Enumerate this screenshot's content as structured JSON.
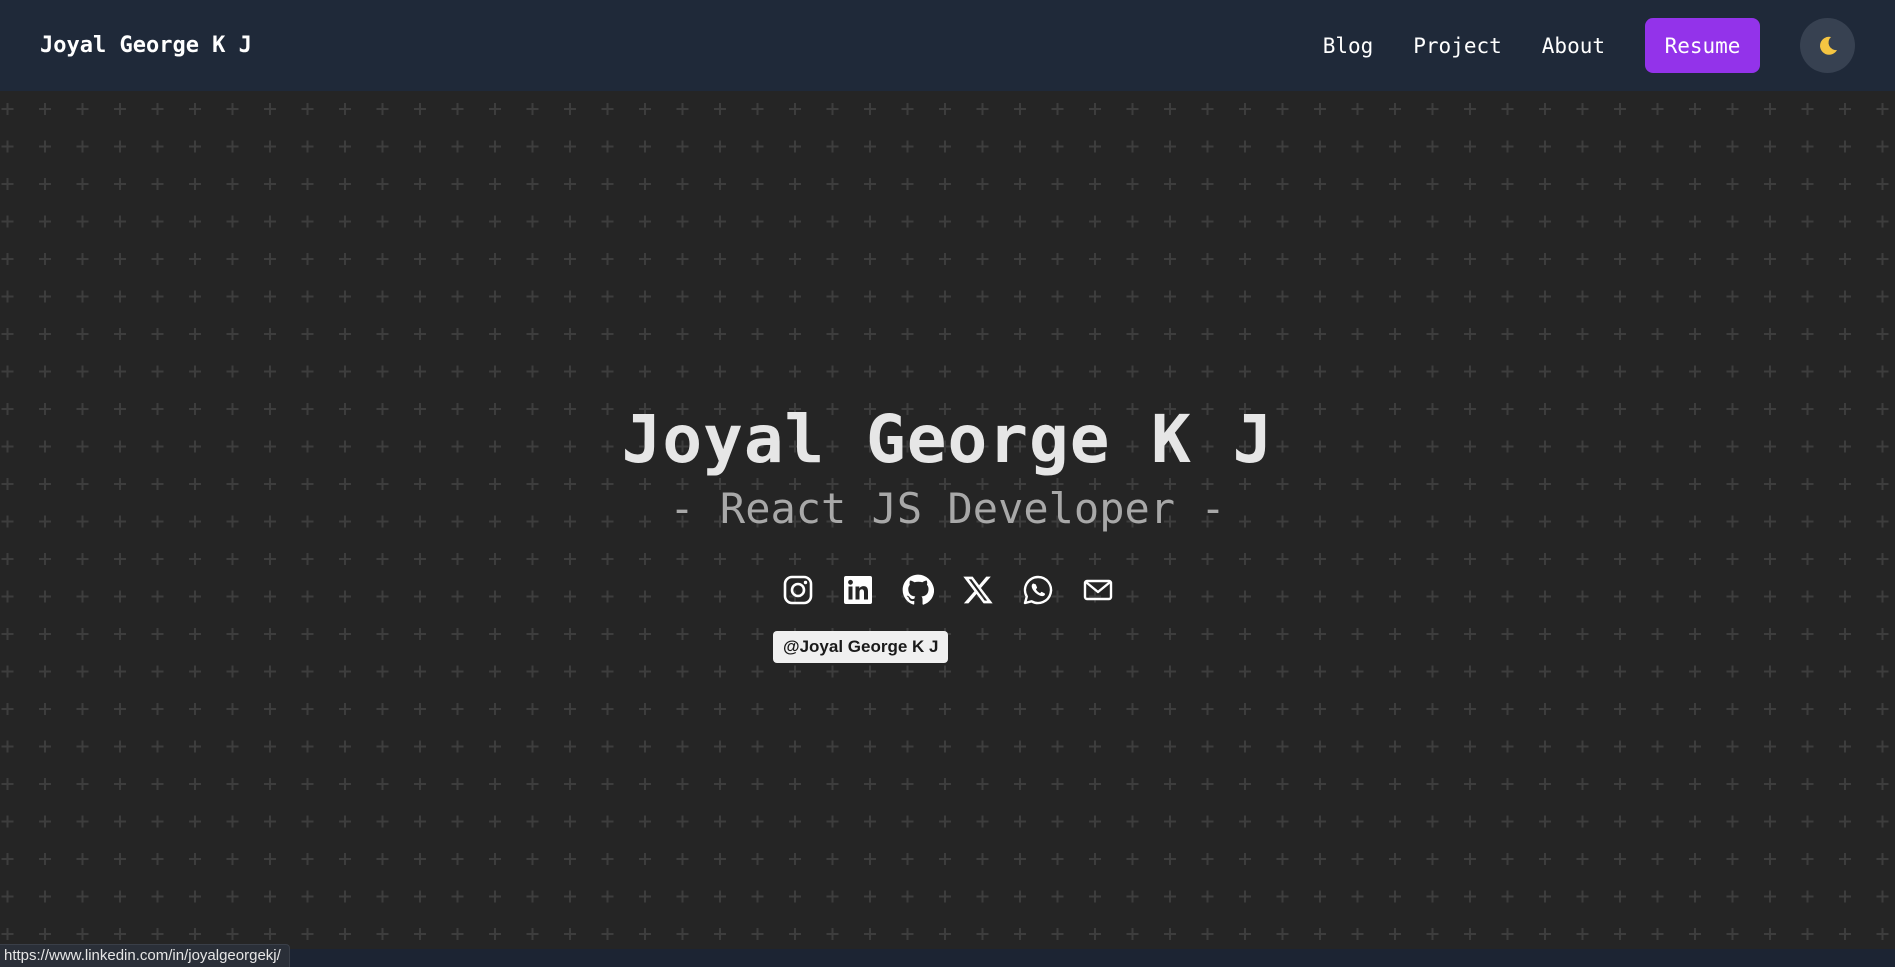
{
  "navbar": {
    "brand": "Joyal George K J",
    "links": [
      "Blog",
      "Project",
      "About"
    ],
    "resume_label": "Resume",
    "theme_icon": "moon-icon"
  },
  "hero": {
    "title": "Joyal George K J",
    "subtitle": "- React JS Developer -"
  },
  "socials": [
    "instagram-icon",
    "linkedin-icon",
    "github-icon",
    "x-icon",
    "whatsapp-icon",
    "mail-icon"
  ],
  "tooltip": "@Joyal George K J",
  "status_url": "https://www.linkedin.com/in/joyalgeorgekj/",
  "colors": {
    "background": "#252525",
    "navbar": "#1f2939",
    "accent": "#9333ea",
    "pattern": "#3d3d3d"
  }
}
